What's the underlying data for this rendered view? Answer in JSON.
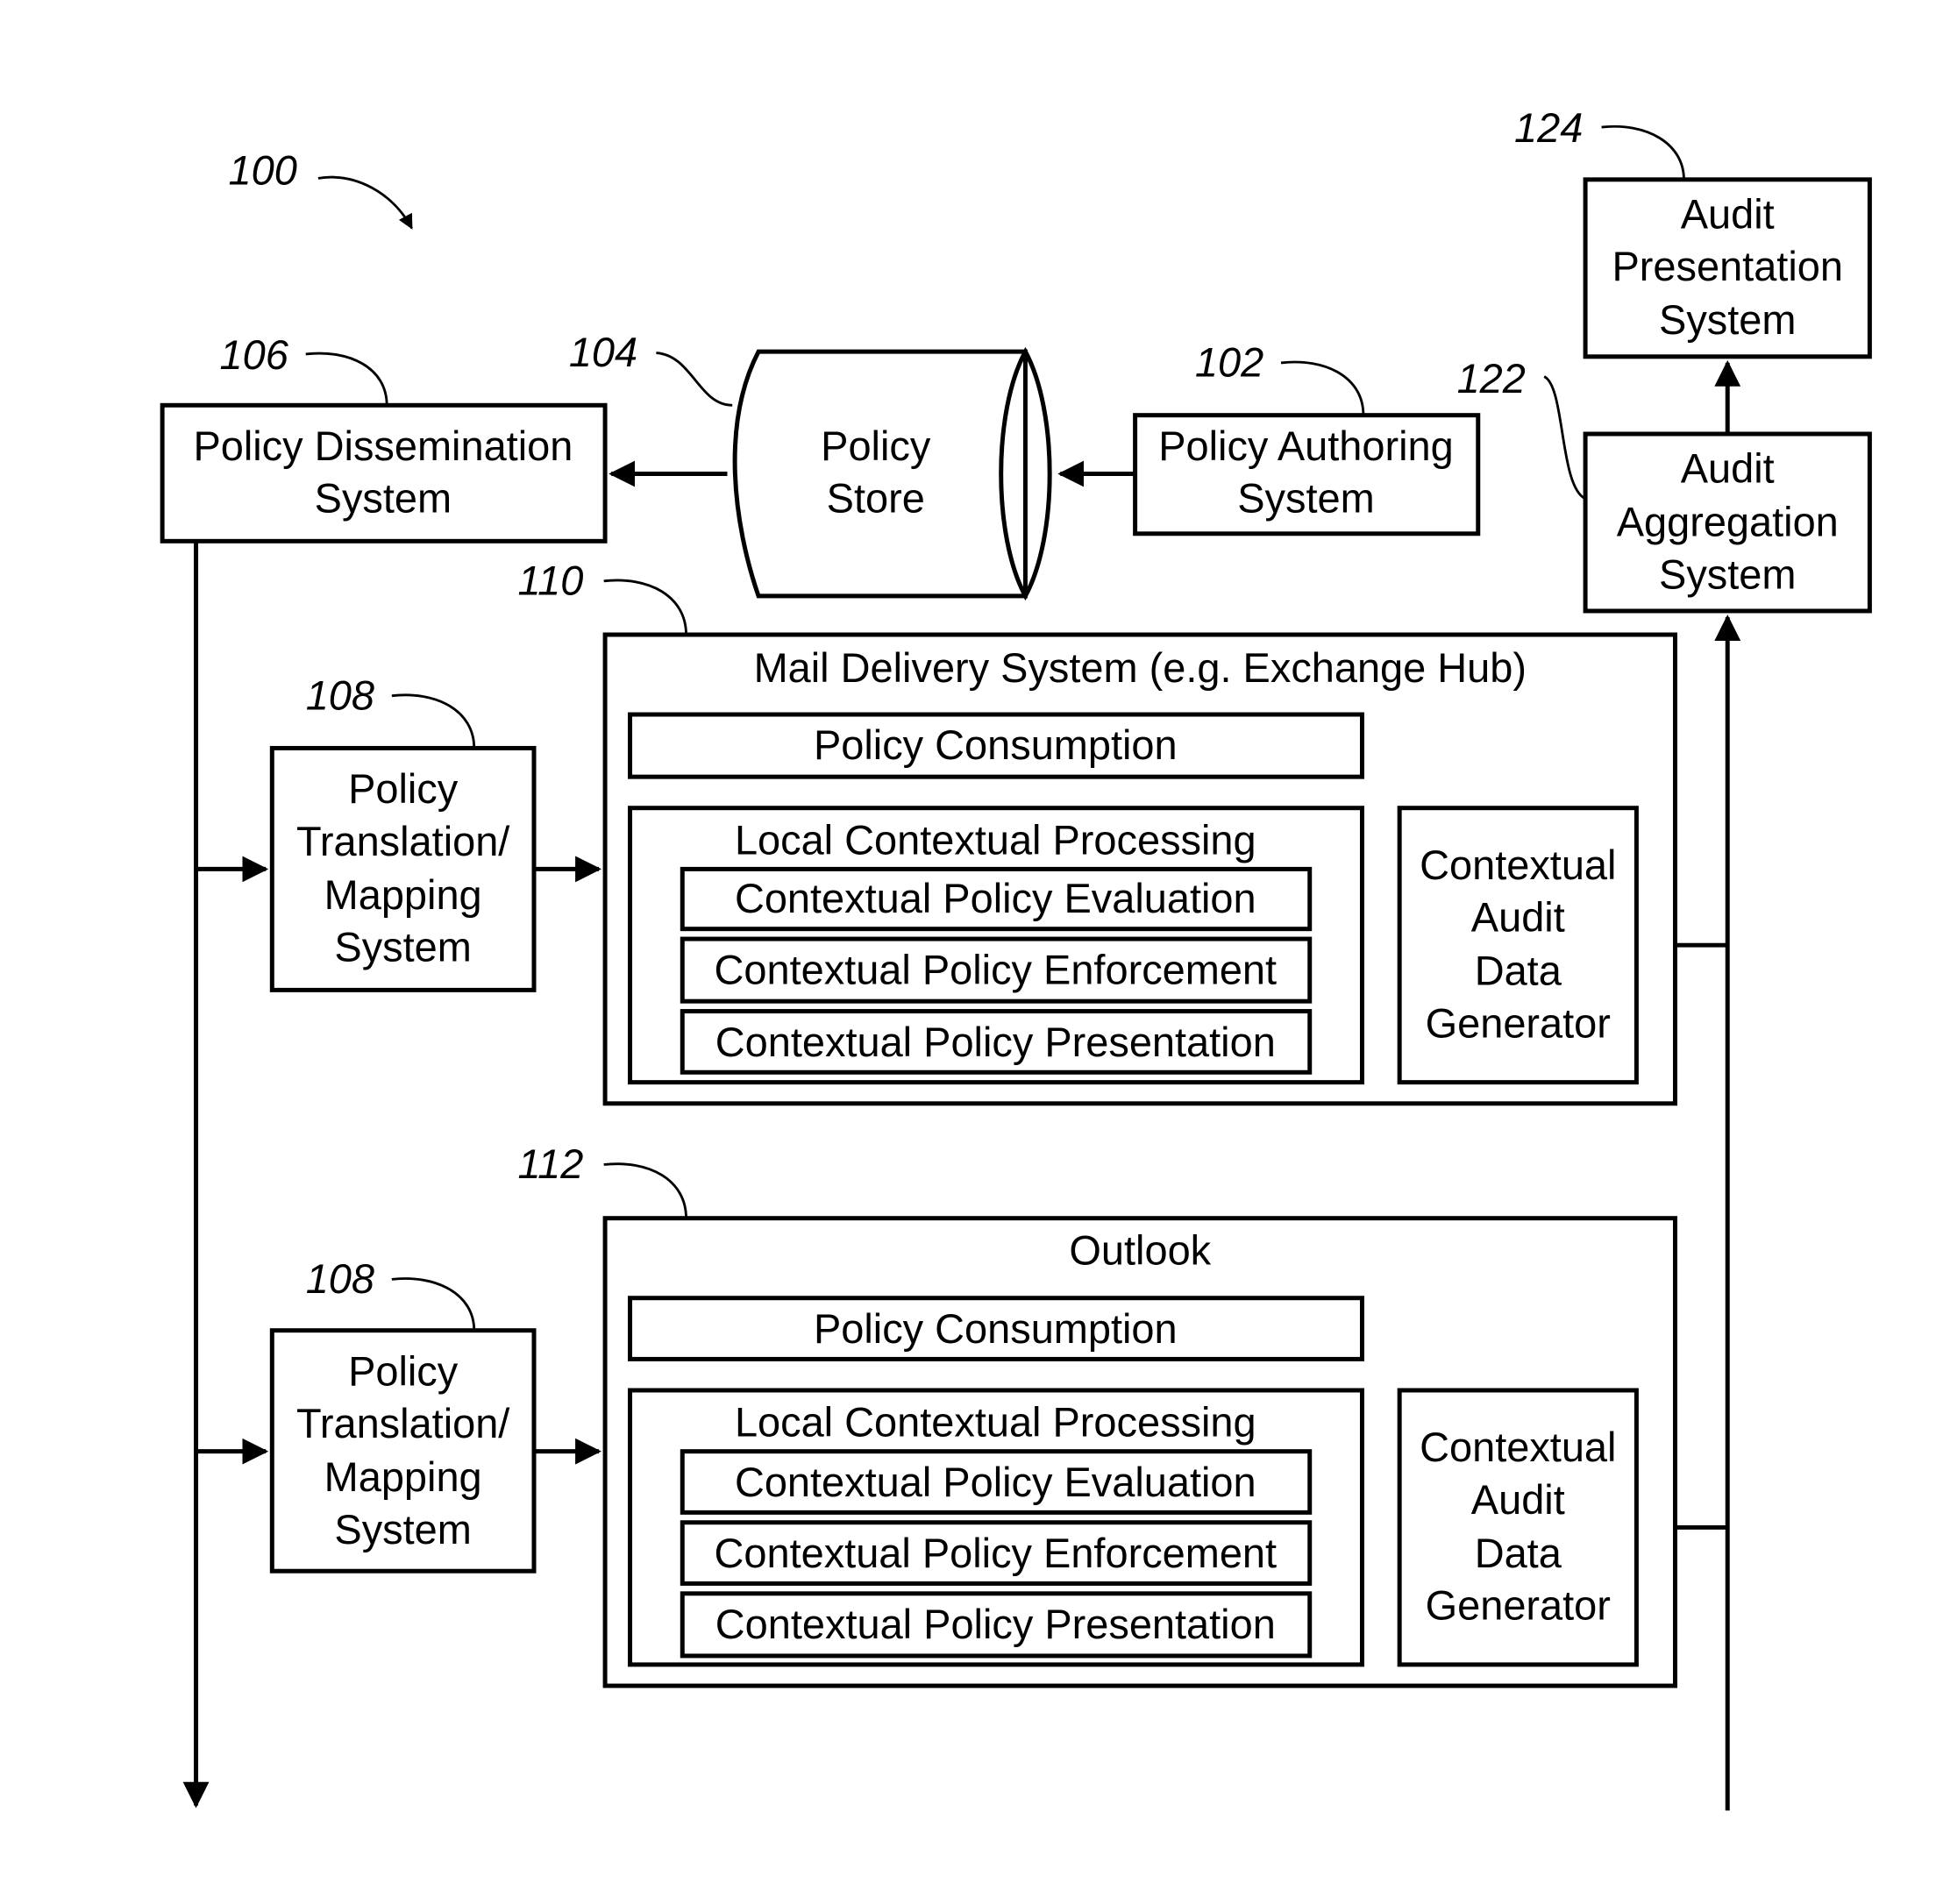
{
  "figure": {
    "ref": "100"
  },
  "policy_dissemination": {
    "ref": "106",
    "lines": [
      "Policy Dissemination",
      "System"
    ]
  },
  "policy_store": {
    "ref": "104",
    "lines": [
      "Policy",
      "Store"
    ]
  },
  "policy_authoring": {
    "ref": "102",
    "lines": [
      "Policy Authoring",
      "System"
    ]
  },
  "audit_presentation": {
    "ref": "124",
    "lines": [
      "Audit",
      "Presentation",
      "System"
    ]
  },
  "audit_aggregation": {
    "ref": "122",
    "lines": [
      "Audit",
      "Aggregation",
      "System"
    ]
  },
  "translation_top": {
    "ref": "108",
    "lines": [
      "Policy",
      "Translation/",
      "Mapping",
      "System"
    ]
  },
  "translation_bottom": {
    "ref": "108",
    "lines": [
      "Policy",
      "Translation/",
      "Mapping",
      "System"
    ]
  },
  "mail_delivery": {
    "ref": "110",
    "title": "Mail Delivery System (e.g. Exchange Hub)",
    "policy_consumption": "Policy Consumption",
    "local_processing": "Local Contextual Processing",
    "evaluation": "Contextual Policy Evaluation",
    "enforcement": "Contextual Policy Enforcement",
    "presentation": "Contextual Policy Presentation",
    "audit_generator": [
      "Contextual",
      "Audit",
      "Data",
      "Generator"
    ]
  },
  "outlook": {
    "ref": "112",
    "title": "Outlook",
    "policy_consumption": "Policy Consumption",
    "local_processing": "Local Contextual Processing",
    "evaluation": "Contextual Policy Evaluation",
    "enforcement": "Contextual Policy Enforcement",
    "presentation": "Contextual Policy Presentation",
    "audit_generator": [
      "Contextual",
      "Audit",
      "Data",
      "Generator"
    ]
  }
}
